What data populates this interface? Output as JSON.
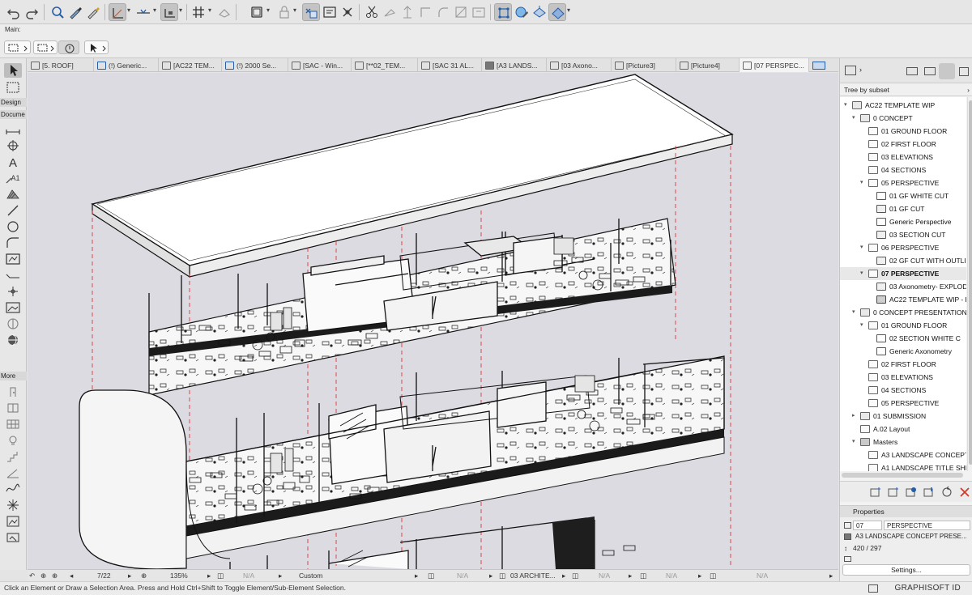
{
  "toolbar": {
    "tools": [
      "undo-icon",
      "redo-icon",
      "find-select-icon",
      "pick-up-icon",
      "inject-icon",
      "guide-lines-icon",
      "snap-guides-icon",
      "relative-construction-icon",
      "grid-snap-icon",
      "suspend-groups-icon",
      "lock-icon",
      "layer-icon",
      "trace-reference-icon",
      "marquee-icon",
      "drag-icon",
      "rotate-icon",
      "mirror-icon",
      "elevate-icon",
      "offset-icon",
      "split-icon",
      "adjust-icon",
      "group-icon",
      "3d-style-icon",
      "render-icon",
      "3d-view-icon"
    ]
  },
  "infobox": {
    "main_label": "Main:"
  },
  "toolbox": {
    "labels": {
      "design": "Design",
      "document": "Docume",
      "more": "More"
    },
    "text_tool_letter": "A",
    "label_tool_text": "A1"
  },
  "tabs": [
    {
      "label": "[5. ROOF]",
      "icon": "floor-plan-icon"
    },
    {
      "label": "(!) Generic...",
      "icon": "3d-icon"
    },
    {
      "label": "[AC22 TEM...",
      "icon": "camera-icon"
    },
    {
      "label": "(!) 2000 Se...",
      "icon": "3d-icon"
    },
    {
      "label": "[SAC - Win...",
      "icon": "schedule-icon"
    },
    {
      "label": "[**02_TEM...",
      "icon": "layout-icon"
    },
    {
      "label": "[SAC 31 AL...",
      "icon": "layout-icon"
    },
    {
      "label": "[A3 LANDS...",
      "icon": "layout-icon"
    },
    {
      "label": "[03 Axono...",
      "icon": "camera-icon"
    },
    {
      "label": "[Picture3]",
      "icon": "camera-icon"
    },
    {
      "label": "[Picture4]",
      "icon": "camera-icon"
    },
    {
      "label": "[07 PERSPEC...",
      "icon": "layout-icon"
    }
  ],
  "status": {
    "page": "7/22",
    "zoom": "135%",
    "na1": "N/A",
    "scale": "Custom",
    "na2": "N/A",
    "layer_combo": "03 ARCHITE...",
    "na3": "N/A",
    "na4": "N/A",
    "na5": "N/A"
  },
  "hint": "Click an Element or Draw a Selection Area. Press and Hold Ctrl+Shift to Toggle Element/Sub-Element Selection.",
  "brand": "GRAPHISOFT ID",
  "navigator": {
    "tree_mode": "Tree by subset",
    "tree": [
      {
        "label": "AC22 TEMPLATE WIP",
        "depth": 0,
        "exp": "▾",
        "icon": "book"
      },
      {
        "label": "0 CONCEPT",
        "depth": 1,
        "exp": "▾",
        "icon": "book"
      },
      {
        "label": "01 GROUND FLOOR",
        "depth": 2,
        "exp": "",
        "icon": "layout"
      },
      {
        "label": "02 FIRST FLOOR",
        "depth": 2,
        "exp": "",
        "icon": "layout"
      },
      {
        "label": "03 ELEVATIONS",
        "depth": 2,
        "exp": "",
        "icon": "layout"
      },
      {
        "label": "04 SECTIONS",
        "depth": 2,
        "exp": "",
        "icon": "layout"
      },
      {
        "label": "05 PERSPECTIVE",
        "depth": 2,
        "exp": "▾",
        "icon": "layout"
      },
      {
        "label": "01 GF WHITE CUT",
        "depth": 3,
        "exp": "",
        "icon": "3d"
      },
      {
        "label": "01 GF CUT",
        "depth": 3,
        "exp": "",
        "icon": "camera"
      },
      {
        "label": "Generic Perspective",
        "depth": 3,
        "exp": "",
        "icon": "3d"
      },
      {
        "label": "03 SECTION CUT",
        "depth": 3,
        "exp": "",
        "icon": "camera"
      },
      {
        "label": "06 PERSPECTIVE",
        "depth": 2,
        "exp": "▾",
        "icon": "layout"
      },
      {
        "label": "02 GF CUT WITH OUTLIN",
        "depth": 3,
        "exp": "",
        "icon": "camera"
      },
      {
        "label": "07 PERSPECTIVE",
        "depth": 2,
        "exp": "▾",
        "icon": "layout",
        "selected": true
      },
      {
        "label": "03 Axonometry- EXPLOD",
        "depth": 3,
        "exp": "",
        "icon": "camera"
      },
      {
        "label": "AC22 TEMPLATE WIP - F",
        "depth": 3,
        "exp": "",
        "icon": "picture"
      },
      {
        "label": "0 CONCEPT PRESENTATION",
        "depth": 1,
        "exp": "▾",
        "icon": "book"
      },
      {
        "label": "01 GROUND FLOOR",
        "depth": 2,
        "exp": "▾",
        "icon": "layout"
      },
      {
        "label": "02 SECTION WHITE C",
        "depth": 3,
        "exp": "",
        "icon": "3d"
      },
      {
        "label": "Generic Axonometry",
        "depth": 3,
        "exp": "",
        "icon": "3d"
      },
      {
        "label": "02 FIRST FLOOR",
        "depth": 2,
        "exp": "",
        "icon": "layout"
      },
      {
        "label": "03 ELEVATIONS",
        "depth": 2,
        "exp": "",
        "icon": "layout"
      },
      {
        "label": "04 SECTIONS",
        "depth": 2,
        "exp": "",
        "icon": "layout"
      },
      {
        "label": "05 PERSPECTIVE",
        "depth": 2,
        "exp": "",
        "icon": "layout"
      },
      {
        "label": "01 SUBMISSION",
        "depth": 1,
        "exp": "▸",
        "icon": "book"
      },
      {
        "label": "A.02 Layout",
        "depth": 1,
        "exp": "",
        "icon": "layout"
      },
      {
        "label": "Masters",
        "depth": 1,
        "exp": "▾",
        "icon": "folder"
      },
      {
        "label": "A3 LANDSCAPE CONCEPT",
        "depth": 2,
        "exp": "",
        "icon": "layout"
      },
      {
        "label": "A1 LANDSCAPE TITLE SHEE",
        "depth": 2,
        "exp": "",
        "icon": "layout"
      }
    ],
    "actions": [
      "new-layout-icon",
      "new-subset-icon",
      "place-drawing-icon",
      "publish-icon",
      "update-icon",
      "delete-icon"
    ],
    "properties": {
      "title": "Properties",
      "id": "07",
      "name": "PERSPECTIVE",
      "master": "A3 LANDSCAPE CONCEPT PRESE...",
      "size": "420 / 297",
      "settings": "Settings..."
    }
  },
  "colors": {
    "canvas": "#dcdbe2",
    "dashed_line": "#d93a3a",
    "delete": "#d23a2a"
  }
}
